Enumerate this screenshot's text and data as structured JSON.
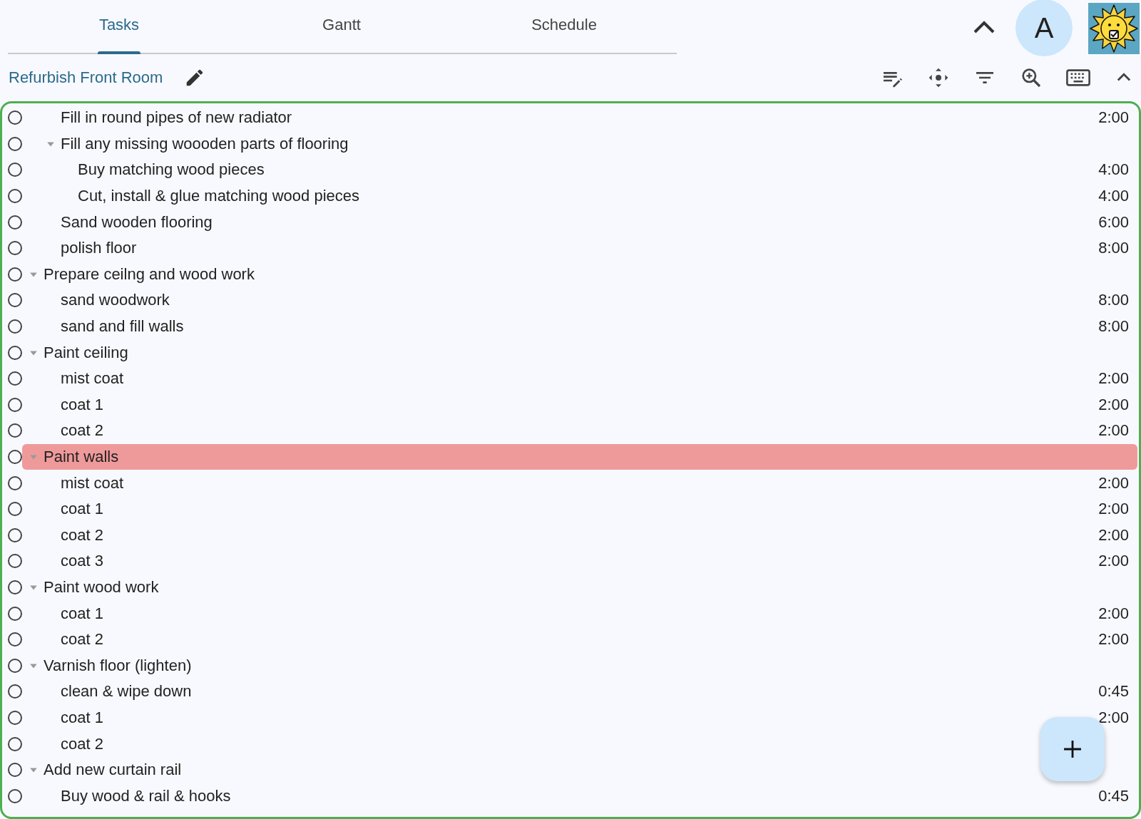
{
  "tabs": [
    {
      "label": "Tasks",
      "selected": true
    },
    {
      "label": "Gantt",
      "selected": false
    },
    {
      "label": "Schedule",
      "selected": false
    }
  ],
  "avatar": {
    "initial": "A"
  },
  "project": {
    "title": "Refurbish Front Room"
  },
  "tasks": [
    {
      "children": [
        {
          "label": "Fill in round pipes of new radiator",
          "duration": "2:00",
          "done": false,
          "selected": false
        },
        {
          "label": "Fill any missing woooden parts of flooring",
          "done": false,
          "selected": false,
          "expanded": true,
          "children": [
            {
              "label": "Buy matching wood pieces",
              "duration": "4:00",
              "done": false,
              "selected": false
            },
            {
              "label": "Cut, install & glue matching wood pieces",
              "duration": "4:00",
              "done": false,
              "selected": false
            }
          ]
        },
        {
          "label": "Sand wooden flooring",
          "duration": "6:00",
          "done": false,
          "selected": false
        },
        {
          "label": "polish floor",
          "duration": "8:00",
          "done": false,
          "selected": false
        }
      ]
    },
    {
      "label": "Prepare ceilng and wood work",
      "done": false,
      "selected": false,
      "expanded": true,
      "children": [
        {
          "label": "sand woodwork",
          "duration": "8:00",
          "done": false,
          "selected": false
        },
        {
          "label": "sand and fill walls",
          "duration": "8:00",
          "done": false,
          "selected": false
        }
      ]
    },
    {
      "label": "Paint ceiling",
      "done": false,
      "selected": false,
      "expanded": true,
      "children": [
        {
          "label": "mist coat",
          "duration": "2:00",
          "done": false,
          "selected": false
        },
        {
          "label": "coat 1",
          "duration": "2:00",
          "done": false,
          "selected": false
        },
        {
          "label": "coat 2",
          "duration": "2:00",
          "done": false,
          "selected": false
        }
      ]
    },
    {
      "label": "Paint walls",
      "done": false,
      "selected": true,
      "expanded": true,
      "children": [
        {
          "label": "mist coat",
          "duration": "2:00",
          "done": false,
          "selected": false
        },
        {
          "label": "coat 1",
          "duration": "2:00",
          "done": false,
          "selected": false
        },
        {
          "label": "coat 2",
          "duration": "2:00",
          "done": false,
          "selected": false
        },
        {
          "label": "coat 3",
          "duration": "2:00",
          "done": false,
          "selected": false
        }
      ]
    },
    {
      "label": "Paint wood work",
      "done": false,
      "selected": false,
      "expanded": true,
      "children": [
        {
          "label": "coat 1",
          "duration": "2:00",
          "done": false,
          "selected": false
        },
        {
          "label": "coat 2",
          "duration": "2:00",
          "done": false,
          "selected": false
        }
      ]
    },
    {
      "label": "Varnish floor (lighten)",
      "done": false,
      "selected": false,
      "expanded": true,
      "children": [
        {
          "label": "clean & wipe down",
          "duration": "0:45",
          "done": false,
          "selected": false
        },
        {
          "label": "coat 1",
          "duration": "2:00",
          "done": false,
          "selected": false
        },
        {
          "label": "coat 2",
          "done": false,
          "selected": false
        }
      ]
    },
    {
      "label": "Add new curtain rail",
      "done": false,
      "selected": false,
      "expanded": true,
      "children": [
        {
          "label": "Buy wood & rail & hooks",
          "duration": "0:45",
          "done": false,
          "selected": false
        }
      ]
    }
  ]
}
